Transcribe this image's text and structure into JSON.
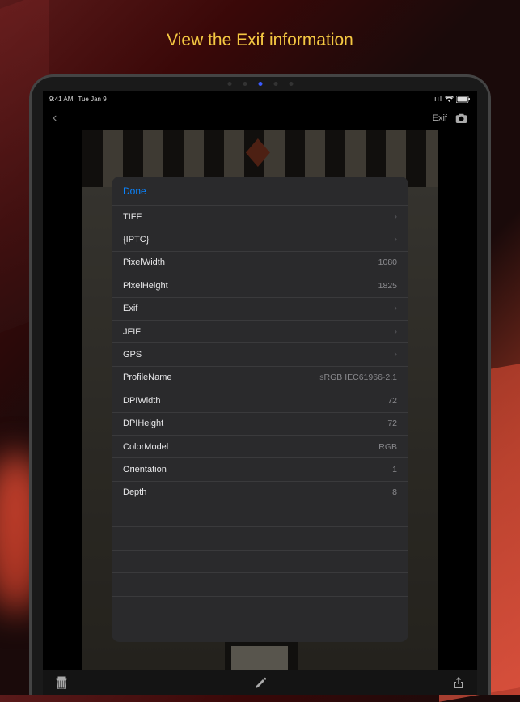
{
  "title": "View the Exif information",
  "status": {
    "time": "9:41 AM",
    "date": "Tue Jan 9"
  },
  "nav": {
    "exif_label": "Exif"
  },
  "panel": {
    "done_label": "Done",
    "rows": [
      {
        "label": "TIFF",
        "type": "disclosure"
      },
      {
        "label": "{IPTC}",
        "type": "disclosure"
      },
      {
        "label": "PixelWidth",
        "value": "1080"
      },
      {
        "label": "PixelHeight",
        "value": "1825"
      },
      {
        "label": "Exif",
        "type": "disclosure"
      },
      {
        "label": "JFIF",
        "type": "disclosure"
      },
      {
        "label": "GPS",
        "type": "disclosure"
      },
      {
        "label": "ProfileName",
        "value": "sRGB IEC61966-2.1"
      },
      {
        "label": "DPIWidth",
        "value": "72"
      },
      {
        "label": "DPIHeight",
        "value": "72"
      },
      {
        "label": "ColorModel",
        "value": "RGB"
      },
      {
        "label": "Orientation",
        "value": "1"
      },
      {
        "label": "Depth",
        "value": "8"
      }
    ]
  }
}
